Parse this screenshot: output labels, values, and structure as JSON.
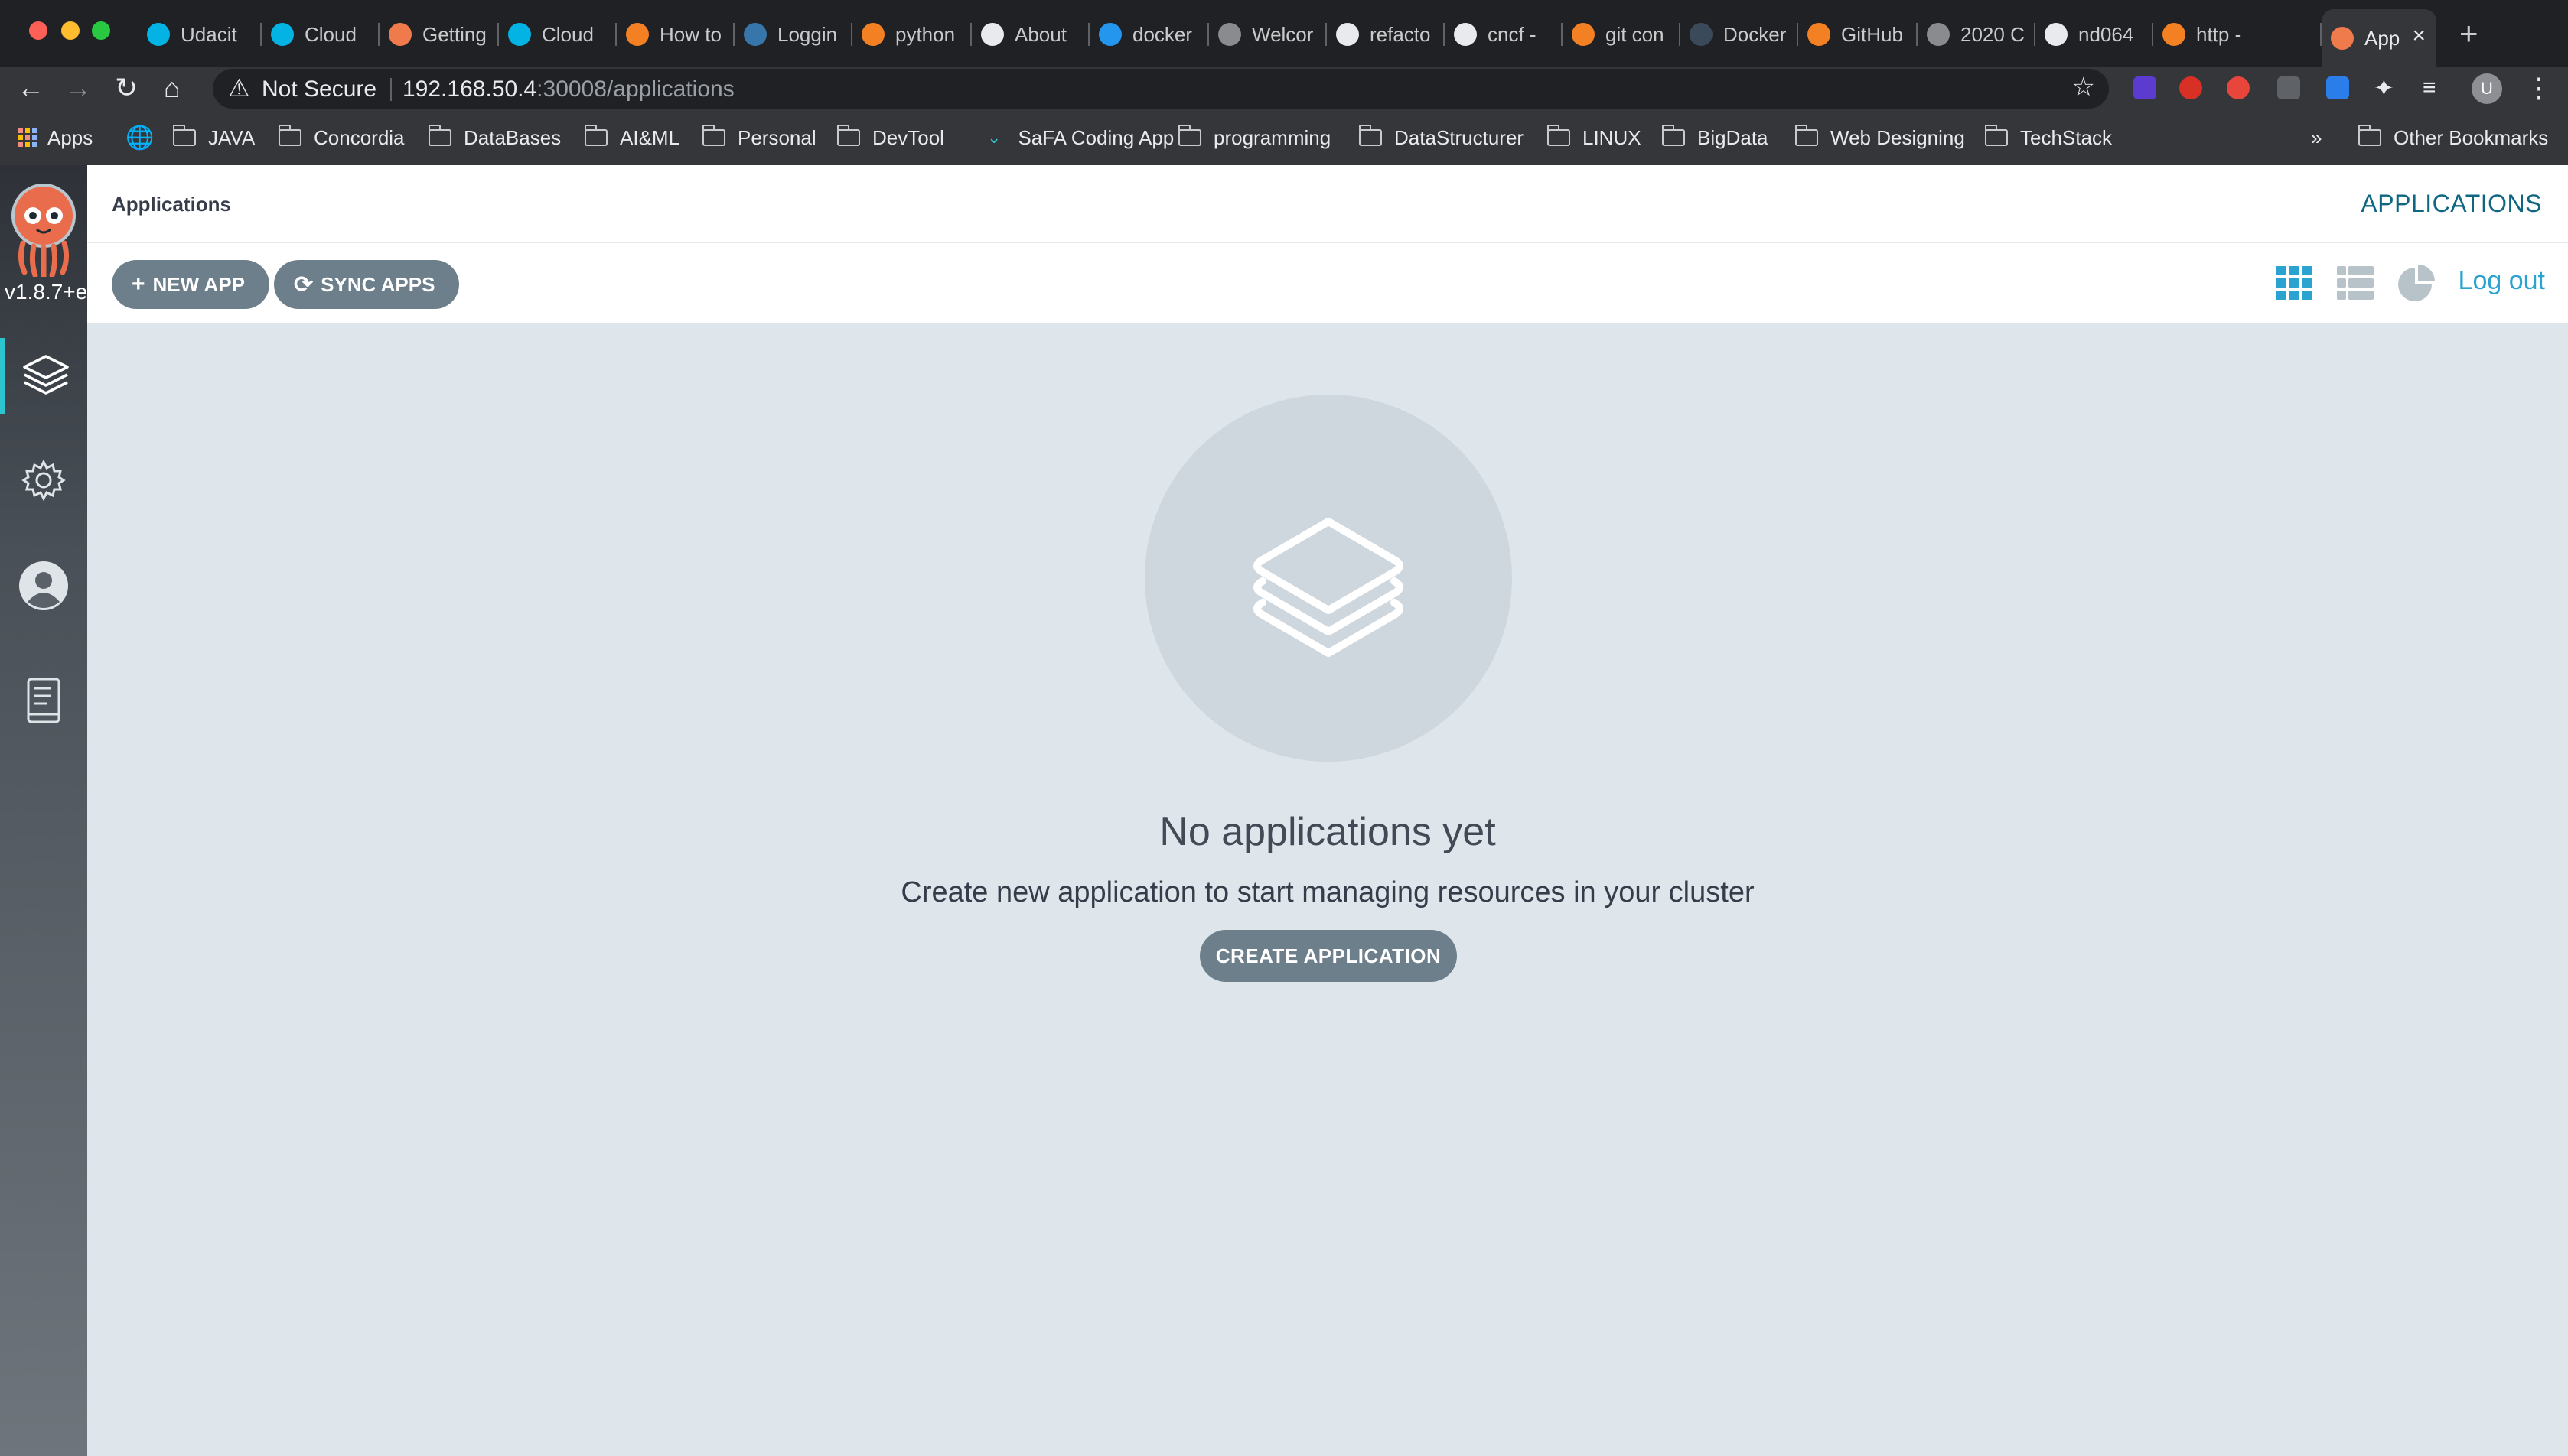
{
  "browser": {
    "tabs": [
      {
        "title": "Udacit",
        "icon": "udacity-icon",
        "color": "#02b3e4"
      },
      {
        "title": "Cloud",
        "icon": "udacity-icon",
        "color": "#02b3e4"
      },
      {
        "title": "Getting",
        "icon": "argo-icon",
        "color": "#ef7b4d"
      },
      {
        "title": "Cloud",
        "icon": "udacity-icon",
        "color": "#02b3e4"
      },
      {
        "title": "How to",
        "icon": "stackoverflow-icon",
        "color": "#f48024"
      },
      {
        "title": "Loggin",
        "icon": "python-icon",
        "color": "#3776ab"
      },
      {
        "title": "python",
        "icon": "stackoverflow-icon",
        "color": "#f48024"
      },
      {
        "title": "About",
        "icon": "globe-icon",
        "color": "#e8eaed"
      },
      {
        "title": "docker",
        "icon": "docker-icon",
        "color": "#2496ed"
      },
      {
        "title": "Welcor",
        "icon": "globe-icon",
        "color": "#8a8b8e"
      },
      {
        "title": "refacto",
        "icon": "github-icon",
        "color": "#e8eaed"
      },
      {
        "title": "cncf -",
        "icon": "google-icon",
        "color": "#e8eaed"
      },
      {
        "title": "git con",
        "icon": "stackoverflow-icon",
        "color": "#f48024"
      },
      {
        "title": "Docker",
        "icon": "docker-icon",
        "color": "#3b4a5a"
      },
      {
        "title": "GitHub",
        "icon": "stackoverflow-icon",
        "color": "#f48024"
      },
      {
        "title": "2020 C",
        "icon": "globe-icon",
        "color": "#8a8b8e"
      },
      {
        "title": "nd064",
        "icon": "github-icon",
        "color": "#e8eaed"
      },
      {
        "title": "http -",
        "icon": "stackoverflow-icon",
        "color": "#f48024"
      },
      {
        "title": "App",
        "icon": "argo-icon",
        "color": "#ef7b4d",
        "active": true
      }
    ],
    "address": {
      "security_label": "Not Secure",
      "host": "192.168.50.4",
      "path": ":30008/applications"
    },
    "bookmarks": {
      "apps_label": "Apps",
      "items": [
        "JAVA",
        "Concordia",
        "DataBases",
        "AI&ML",
        "Personal",
        "DevTool",
        "SaFA Coding App",
        "programming",
        "DataStructurer",
        "LINUX",
        "BigData",
        "Web Designing",
        "TechStack"
      ],
      "overflow": "»",
      "other": "Other Bookmarks"
    },
    "profile_initial": "U"
  },
  "app": {
    "version": "v1.8.7+e",
    "breadcrumb": "Applications",
    "page_title": "APPLICATIONS",
    "buttons": {
      "new_app": "NEW APP",
      "sync_apps": "SYNC APPS",
      "logout": "Log out"
    },
    "empty_state": {
      "title": "No applications yet",
      "subtitle": "Create new application to start managing resources in your cluster",
      "cta": "CREATE APPLICATION"
    },
    "colors": {
      "accent": "#0e6681",
      "link": "#2aa3d0",
      "button": "#6d7f8b",
      "sidebar_active": "#2ec4cf",
      "background": "#dee6eb"
    }
  }
}
